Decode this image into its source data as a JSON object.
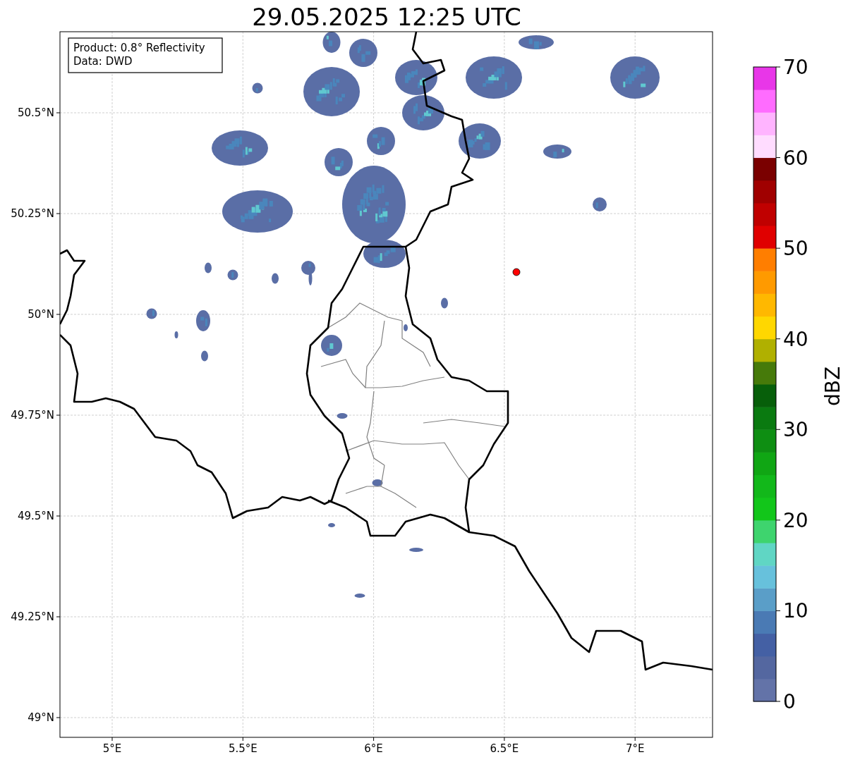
{
  "title": "29.05.2025 12:25 UTC",
  "info_box": [
    "Product: 0.8° Reflectivity",
    "Data: DWD"
  ],
  "map": {
    "lat_labels": [
      "50.5°N",
      "50.25°N",
      "50°N",
      "49.75°N",
      "49.5°N",
      "49.25°N",
      "49°N"
    ],
    "lon_labels": [
      "5°E",
      "5.5°E",
      "6°E",
      "6.5°E",
      "7°E"
    ]
  },
  "colorbar": {
    "label": "dBZ",
    "ticks": [
      "70",
      "60",
      "50",
      "40",
      "30",
      "20",
      "10",
      "0"
    ],
    "bins": [
      {
        "color": "#6373a8"
      },
      {
        "color": "#5467a0"
      },
      {
        "color": "#4460a4"
      },
      {
        "color": "#4a7ab4"
      },
      {
        "color": "#5a9ec8"
      },
      {
        "color": "#67c1dc"
      },
      {
        "color": "#60d6c4"
      },
      {
        "color": "#3ed46e"
      },
      {
        "color": "#12c61a"
      },
      {
        "color": "#12b81a"
      },
      {
        "color": "#10a614"
      },
      {
        "color": "#0e8e12"
      },
      {
        "color": "#0a7a10"
      },
      {
        "color": "#075f0a"
      },
      {
        "color": "#467a0a"
      },
      {
        "color": "#b0b000"
      },
      {
        "color": "#ffd700"
      },
      {
        "color": "#ffb800"
      },
      {
        "color": "#ff9a00"
      },
      {
        "color": "#ff7e00"
      },
      {
        "color": "#e00000"
      },
      {
        "color": "#c00000"
      },
      {
        "color": "#a00000"
      },
      {
        "color": "#7a0000"
      },
      {
        "color": "#ffdcff"
      },
      {
        "color": "#ffb4ff"
      },
      {
        "color": "#ff6cff"
      },
      {
        "color": "#e836e8"
      }
    ]
  }
}
